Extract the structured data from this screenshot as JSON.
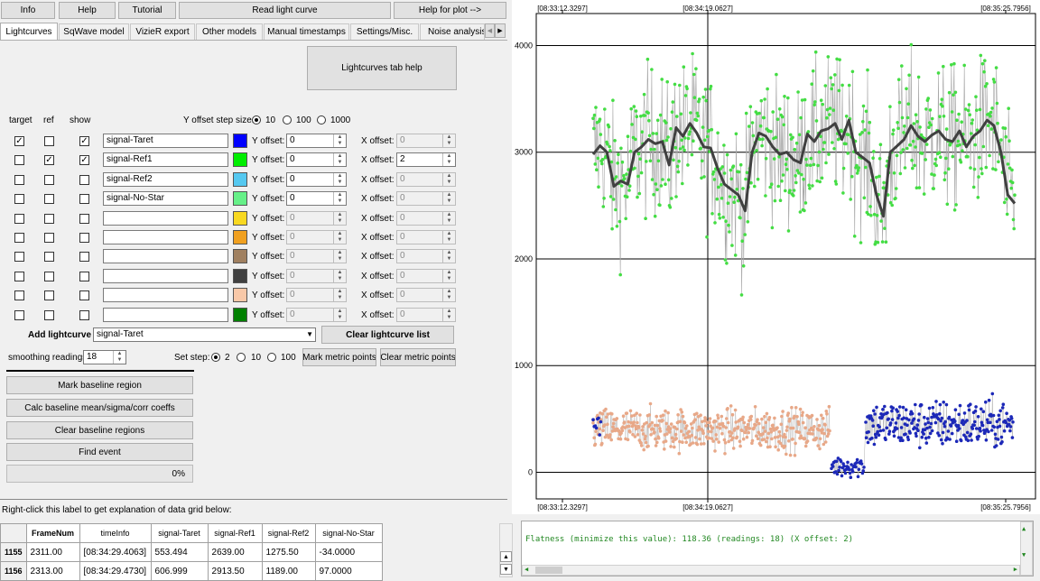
{
  "toolbar": {
    "info": "Info",
    "help": "Help",
    "tutorial": "Tutorial",
    "read_light_curve": "Read light curve",
    "help_for_plot": "Help for plot -->"
  },
  "tabs": [
    {
      "label": "Lightcurves"
    },
    {
      "label": "SqWave model"
    },
    {
      "label": "VizieR export"
    },
    {
      "label": "Other models"
    },
    {
      "label": "Manual timestamps"
    },
    {
      "label": "Settings/Misc."
    },
    {
      "label": "Noise analysis/I"
    }
  ],
  "lightcurves_tab_help": "Lightcurves tab help",
  "headers": {
    "target": "target",
    "ref": "ref",
    "show": "show"
  },
  "y_offset_step": {
    "label": "Y offset step size:",
    "options": [
      "10",
      "100",
      "1000"
    ],
    "selected": "10"
  },
  "labels": {
    "y_offset": "Y offset:",
    "x_offset": "X offset:"
  },
  "rows": [
    {
      "target": true,
      "ref": false,
      "show": true,
      "name": "signal-Taret",
      "color": "#0000ff",
      "y": "0",
      "x": "0",
      "active": true,
      "x_enabled": false
    },
    {
      "target": false,
      "ref": true,
      "show": true,
      "name": "signal-Ref1",
      "color": "#00ee00",
      "y": "0",
      "x": "2",
      "active": true,
      "x_enabled": true
    },
    {
      "target": false,
      "ref": false,
      "show": false,
      "name": "signal-Ref2",
      "color": "#55c8f0",
      "y": "0",
      "x": "0",
      "active": true,
      "x_enabled": false
    },
    {
      "target": false,
      "ref": false,
      "show": false,
      "name": "signal-No-Star",
      "color": "#66f088",
      "y": "0",
      "x": "0",
      "active": true,
      "x_enabled": false
    },
    {
      "target": false,
      "ref": false,
      "show": false,
      "name": "",
      "color": "#f8d820",
      "y": "0",
      "x": "0",
      "active": false,
      "x_enabled": false
    },
    {
      "target": false,
      "ref": false,
      "show": false,
      "name": "",
      "color": "#f0a020",
      "y": "0",
      "x": "0",
      "active": false,
      "x_enabled": false
    },
    {
      "target": false,
      "ref": false,
      "show": false,
      "name": "",
      "color": "#a08060",
      "y": "0",
      "x": "0",
      "active": false,
      "x_enabled": false
    },
    {
      "target": false,
      "ref": false,
      "show": false,
      "name": "",
      "color": "#404040",
      "y": "0",
      "x": "0",
      "active": false,
      "x_enabled": false
    },
    {
      "target": false,
      "ref": false,
      "show": false,
      "name": "",
      "color": "#f8c8a8",
      "y": "0",
      "x": "0",
      "active": false,
      "x_enabled": false
    },
    {
      "target": false,
      "ref": false,
      "show": false,
      "name": "",
      "color": "#008000",
      "y": "0",
      "x": "0",
      "active": false,
      "x_enabled": false
    }
  ],
  "add_lightcurve": {
    "label": "Add lightcurve",
    "selected": "signal-Taret"
  },
  "clear_lightcurve_list": "Clear lightcurve list",
  "smoothing": {
    "label": "smoothing readings",
    "value": "18"
  },
  "set_step": {
    "label": "Set step:",
    "options": [
      "2",
      "10",
      "100"
    ],
    "selected": "2"
  },
  "mark_metric_points": "Mark metric points",
  "clear_metric_points": "Clear metric points",
  "actions": {
    "mark_baseline": "Mark baseline region",
    "calc_baseline": "Calc baseline mean/sigma/corr coeffs",
    "clear_baseline": "Clear baseline regions",
    "find_event": "Find event"
  },
  "progress": {
    "text": "0%",
    "value": 0
  },
  "grid_hint": "Right-click this label to get explanation of data grid below:",
  "grid": {
    "columns": [
      "FrameNum",
      "timeInfo",
      "signal-Taret",
      "signal-Ref1",
      "signal-Ref2",
      "signal-No-Star"
    ],
    "rows": [
      {
        "index": "1155",
        "cells": [
          "2311.00",
          "[08:34:29.4063]",
          "553.494",
          "2639.00",
          "1275.50",
          "-34.0000"
        ]
      },
      {
        "index": "1156",
        "cells": [
          "2313.00",
          "[08:34:29.4730]",
          "606.999",
          "2913.50",
          "1189.00",
          "97.0000"
        ]
      }
    ]
  },
  "output": {
    "message": "Flatness (minimize this value): 118.36 (readings: 18) (X offset: 2)"
  },
  "chart_data": {
    "type": "scatter",
    "x_tick_labels": [
      "[08:33:12.3297]",
      "[08:34:19.0627]",
      "[08:35:25.7956]"
    ],
    "y_ticks": [
      0,
      1000,
      2000,
      3000,
      4000
    ],
    "ylim": [
      -250,
      4300
    ],
    "grid": true,
    "series": [
      {
        "color": "#44dd44",
        "approx_mean": 3000,
        "approx_sd": 450
      },
      {
        "color": "#404040",
        "values": [
          2980,
          3060,
          3000,
          2680,
          2730,
          2700,
          3000,
          3050,
          3120,
          3080,
          3100,
          2880,
          3230,
          3150,
          3270,
          3180,
          3050,
          3040,
          2850,
          2700,
          2650,
          2600,
          2450,
          3000,
          3180,
          3150,
          3050,
          2980,
          3000,
          2930,
          2900,
          3170,
          3100,
          3200,
          3220,
          3270,
          3120,
          3300,
          3000,
          2950,
          2900,
          2600,
          2400,
          3000,
          3060,
          3120,
          3250,
          3150,
          3100,
          3160,
          3200,
          3120,
          3100,
          3200,
          3050,
          3150,
          3200,
          3300,
          3250,
          3000,
          2600,
          2520
        ]
      },
      {
        "color": "#e8a888",
        "approx_mean": 400,
        "approx_sd": 140
      },
      {
        "color": "#1c28b8",
        "approx_mean": 450,
        "approx_sd": 160,
        "dip_value": 60
      }
    ]
  }
}
